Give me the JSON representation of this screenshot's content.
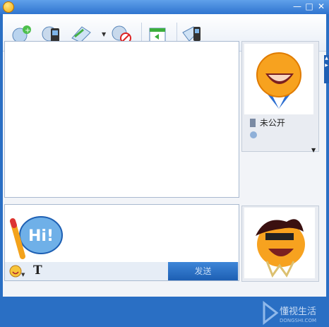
{
  "window": {
    "minimize_glyph": "—",
    "maximize_glyph": "□",
    "close_glyph": "✕"
  },
  "toolbar": {
    "items": [
      {
        "name": "add-contact-icon"
      },
      {
        "name": "phone-icon"
      },
      {
        "name": "file-transfer-icon"
      },
      {
        "name": "block-icon"
      },
      {
        "name": "share-icon"
      },
      {
        "name": "sms-icon"
      }
    ]
  },
  "contact": {
    "status_text": "未公开"
  },
  "input": {
    "font_button": "T",
    "send_label": "发送"
  },
  "watermark": {
    "title": "懂视生活",
    "url": "DONGSHI.COM"
  },
  "colors": {
    "title_bar": "#2f74cf",
    "send_button": "#1d5fb3"
  }
}
